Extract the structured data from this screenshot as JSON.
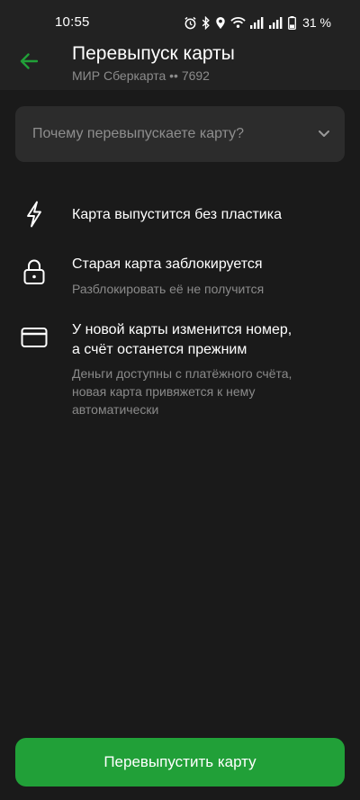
{
  "status_bar": {
    "time": "10:55",
    "battery": "31 %",
    "icons": [
      "alarm-icon",
      "bluetooth-icon",
      "location-icon",
      "wifi-icon",
      "signal-icon",
      "signal-icon",
      "battery-icon"
    ]
  },
  "header": {
    "title": "Перевыпуск карты",
    "subtitle": "МИР Сберкарта •• 7692",
    "back_icon": "arrow-left-icon"
  },
  "reason_select": {
    "placeholder": "Почему перевыпускаете карту?",
    "icon": "chevron-down-icon"
  },
  "info_items": [
    {
      "icon": "lightning-icon",
      "title": "Карта выпустится без пластика",
      "description": ""
    },
    {
      "icon": "lock-icon",
      "title": "Старая карта заблокируется",
      "description": "Разблокировать её не получится"
    },
    {
      "icon": "card-icon",
      "title_line1": "У новой карты изменится номер,",
      "title_line2": "а счёт останется прежним",
      "description_line1": "Деньги доступны с платёжного счёта,",
      "description_line2": "новая карта привяжется к нему",
      "description_line3": "автоматически"
    }
  ],
  "primary_button": {
    "label": "Перевыпустить карту"
  },
  "colors": {
    "accent": "#21a038",
    "background": "#1a1a1a",
    "header": "#222222",
    "field": "#2c2c2c"
  }
}
